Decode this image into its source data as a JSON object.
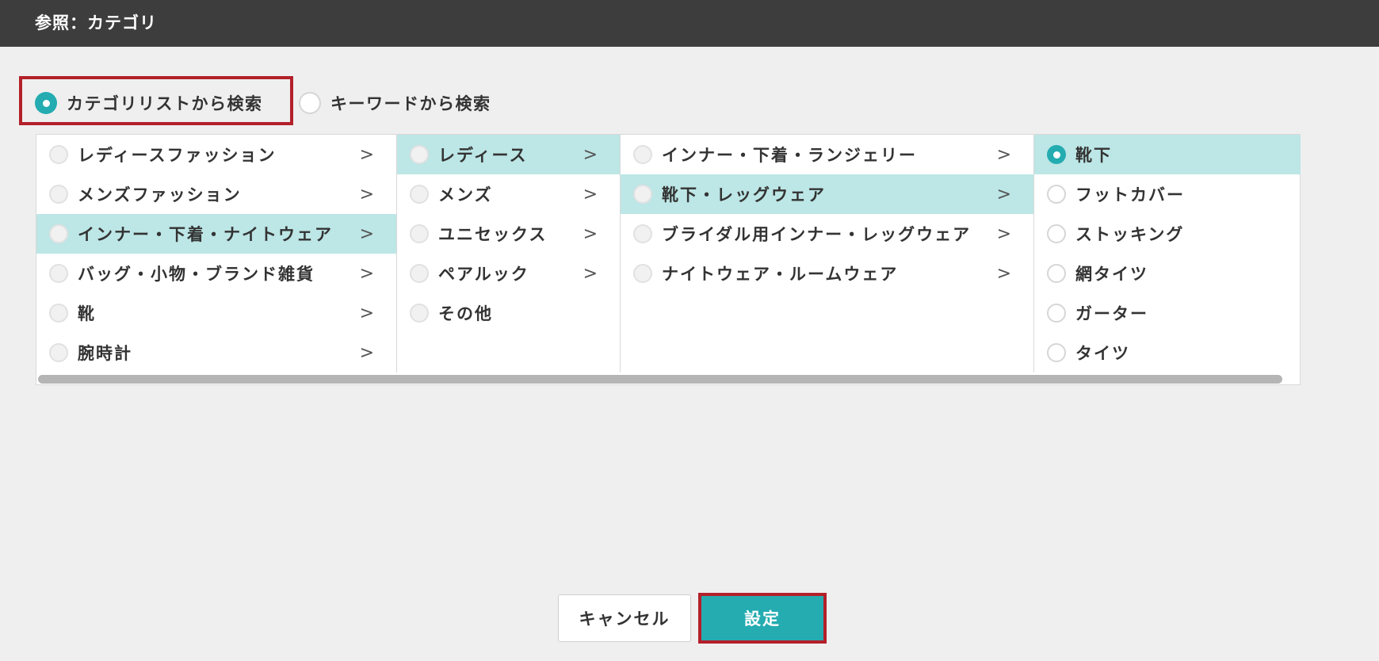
{
  "dialog": {
    "title": "参照：カテゴリ"
  },
  "mode": {
    "options": [
      {
        "label": "カテゴリリストから検索",
        "checked": true
      },
      {
        "label": "キーワードから検索",
        "checked": false
      }
    ]
  },
  "columns": [
    {
      "items": [
        {
          "label": "レディースファッション",
          "chevron": ">",
          "selected": false
        },
        {
          "label": "メンズファッション",
          "chevron": ">",
          "selected": false
        },
        {
          "label": "インナー・下着・ナイトウェア",
          "chevron": ">",
          "selected": true
        },
        {
          "label": "バッグ・小物・ブランド雑貨",
          "chevron": ">",
          "selected": false
        },
        {
          "label": "靴",
          "chevron": ">",
          "selected": false
        },
        {
          "label": "腕時計",
          "chevron": ">",
          "selected": false
        }
      ]
    },
    {
      "items": [
        {
          "label": "レディース",
          "chevron": ">",
          "selected": true
        },
        {
          "label": "メンズ",
          "chevron": ">",
          "selected": false
        },
        {
          "label": "ユニセックス",
          "chevron": ">",
          "selected": false
        },
        {
          "label": "ペアルック",
          "chevron": ">",
          "selected": false
        },
        {
          "label": "その他",
          "chevron": "",
          "selected": false
        }
      ]
    },
    {
      "items": [
        {
          "label": "インナー・下着・ランジェリー",
          "chevron": ">",
          "selected": false
        },
        {
          "label": "靴下・レッグウェア",
          "chevron": ">",
          "selected": true
        },
        {
          "label": "ブライダル用インナー・レッグウェア",
          "chevron": ">",
          "selected": false
        },
        {
          "label": "ナイトウェア・ルームウェア",
          "chevron": ">",
          "selected": false
        }
      ]
    },
    {
      "items": [
        {
          "label": "靴下",
          "chevron": "",
          "selected": true,
          "checked": true
        },
        {
          "label": "フットカバー",
          "chevron": "",
          "selected": false
        },
        {
          "label": "ストッキング",
          "chevron": "",
          "selected": false
        },
        {
          "label": "網タイツ",
          "chevron": "",
          "selected": false
        },
        {
          "label": "ガーター",
          "chevron": "",
          "selected": false
        },
        {
          "label": "タイツ",
          "chevron": "",
          "selected": false
        }
      ]
    }
  ],
  "buttons": {
    "cancel": "キャンセル",
    "ok": "設定"
  },
  "colors": {
    "accent": "#24acb1",
    "selected_row": "#bde6e6",
    "highlight_frame": "#b3202a",
    "titlebar": "#3d3d3d"
  }
}
